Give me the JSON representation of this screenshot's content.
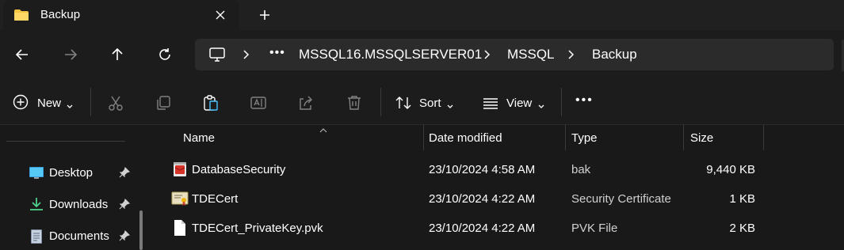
{
  "window": {
    "tab_title": "Backup",
    "tab_icon": "folder-icon",
    "new_tab_icon": "plus-icon",
    "close_icon": "close-icon"
  },
  "navigation": {
    "back_icon": "arrow-left-icon",
    "forward_icon": "arrow-right-icon",
    "up_icon": "arrow-up-icon",
    "refresh_icon": "refresh-icon"
  },
  "address_bar": {
    "root_icon": "this-pc-icon",
    "overflow_label": "•••",
    "breadcrumbs": [
      "MSSQL16.MSSQLSERVER01",
      "MSSQL",
      "Backup"
    ]
  },
  "command_bar": {
    "new_label": "New",
    "sort_label": "Sort",
    "view_label": "View",
    "more_label": "•••",
    "actions": [
      "cut-icon",
      "copy-icon",
      "paste-icon",
      "rename-icon",
      "share-icon",
      "delete-icon"
    ]
  },
  "sidebar": {
    "items": [
      {
        "label": "Desktop",
        "icon": "desktop-icon",
        "pinned": true
      },
      {
        "label": "Downloads",
        "icon": "download-icon",
        "pinned": true
      },
      {
        "label": "Documents",
        "icon": "documents-icon",
        "pinned": true
      }
    ]
  },
  "file_list": {
    "columns": [
      "Name",
      "Date modified",
      "Type",
      "Size"
    ],
    "rows": [
      {
        "name": "DatabaseSecurity",
        "date": "23/10/2024 4:58 AM",
        "type": "bak",
        "size": "9,440 KB",
        "icon": "archive-file-icon"
      },
      {
        "name": "TDECert",
        "date": "23/10/2024 4:22 AM",
        "type": "Security Certificate",
        "size": "1 KB",
        "icon": "certificate-icon"
      },
      {
        "name": "TDECert_PrivateKey.pvk",
        "date": "23/10/2024 4:22 AM",
        "type": "PVK File",
        "size": "2 KB",
        "icon": "blank-file-icon"
      }
    ]
  },
  "colors": {
    "background": "#191919",
    "toolbar": "#1c1c1c",
    "address_field": "#2b2b2b",
    "folder_yellow": "#f5c342",
    "text": "#ffffff"
  }
}
